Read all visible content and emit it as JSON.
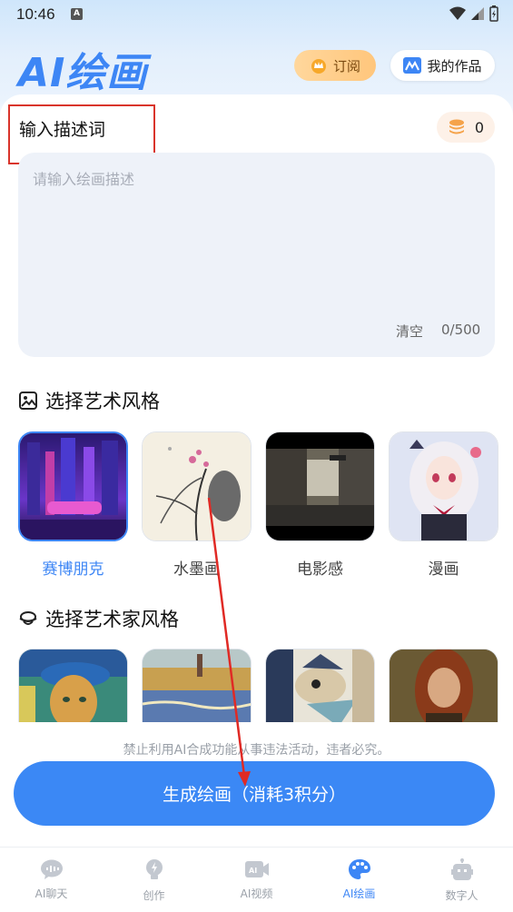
{
  "status_bar": {
    "time": "10:46",
    "badge": "A"
  },
  "header": {
    "logo": "AI绘画",
    "subscribe_label": "订阅",
    "my_works_label": "我的作品"
  },
  "description": {
    "title": "输入描述词",
    "credits": "0",
    "placeholder": "请输入绘画描述",
    "value": "",
    "clear_label": "清空",
    "char_count": "0/500"
  },
  "art_style": {
    "heading": "选择艺术风格",
    "items": [
      {
        "label": "赛博朋克",
        "selected": true
      },
      {
        "label": "水墨画",
        "selected": false
      },
      {
        "label": "电影感",
        "selected": false
      },
      {
        "label": "漫画",
        "selected": false
      }
    ]
  },
  "artist_style": {
    "heading": "选择艺术家风格"
  },
  "footer": {
    "disclaimer": "禁止利用AI合成功能从事违法活动，违者必究。",
    "generate_label": "生成绘画（消耗3积分）"
  },
  "tabs": [
    {
      "label": "AI聊天",
      "icon": "chat-bubble-icon",
      "active": false
    },
    {
      "label": "创作",
      "icon": "lightbulb-icon",
      "active": false
    },
    {
      "label": "AI视频",
      "icon": "video-icon",
      "active": false
    },
    {
      "label": "AI绘画",
      "icon": "palette-icon",
      "active": true
    },
    {
      "label": "数字人",
      "icon": "robot-icon",
      "active": false
    }
  ],
  "colors": {
    "accent": "#3d86f5",
    "highlight": "#d9342b",
    "subscribe_bg": "#ffc67c"
  }
}
